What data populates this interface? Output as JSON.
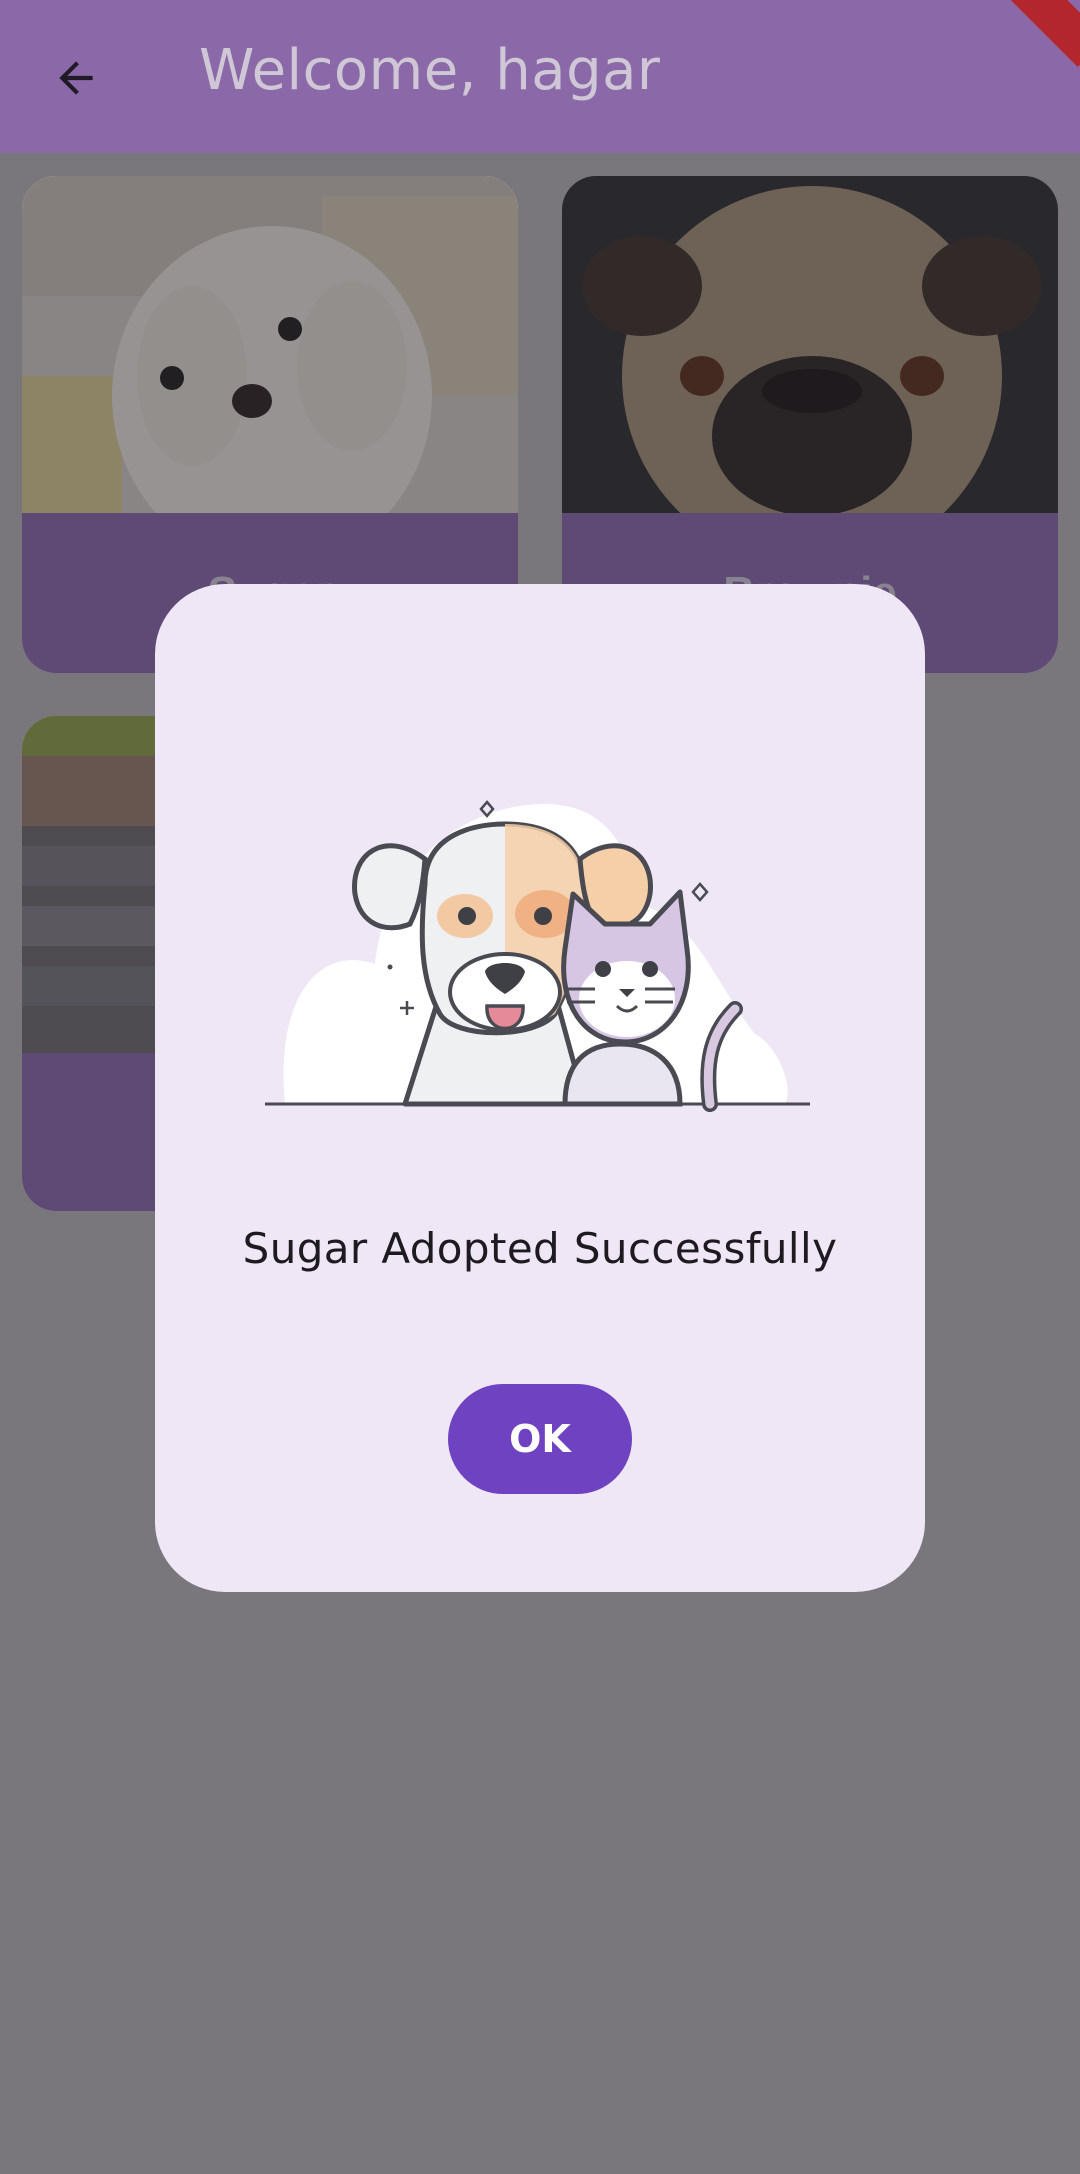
{
  "appbar": {
    "title": "Welcome, hagar",
    "back_icon": "arrow-left-icon"
  },
  "pets": [
    {
      "name": "Sugar"
    },
    {
      "name": "Brownie"
    },
    {
      "name": ""
    }
  ],
  "dialog": {
    "illustration": "dog-and-cat-illustration",
    "message": "Sugar Adopted Successfully",
    "ok_label": "OK"
  },
  "colors": {
    "primary": "#6f42c1",
    "appbar": "#8b69a8",
    "dialog_bg": "#efe6f6",
    "scrim": "#7a777c"
  }
}
